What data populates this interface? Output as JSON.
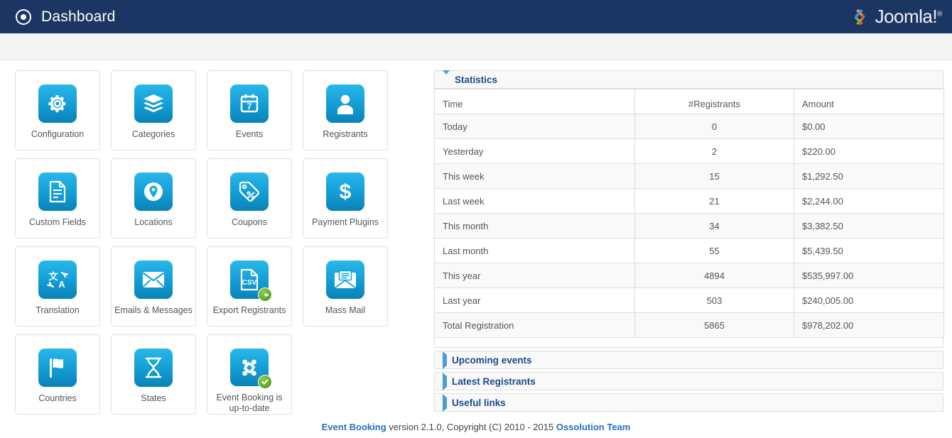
{
  "header": {
    "title": "Dashboard",
    "dashboard_icon": "target-icon",
    "brand_name": "Joomla!",
    "brand_tm": "®",
    "bar_color": "#1c3664"
  },
  "tiles": [
    [
      {
        "label": "Configuration",
        "icon": "gear-icon"
      },
      {
        "label": "Categories",
        "icon": "layers-icon"
      },
      {
        "label": "Events",
        "icon": "calendar-icon",
        "icon_text": "7"
      },
      {
        "label": "Registrants",
        "icon": "user-icon"
      }
    ],
    [
      {
        "label": "Custom Fields",
        "icon": "document-icon"
      },
      {
        "label": "Locations",
        "icon": "map-pin-icon"
      },
      {
        "label": "Coupons",
        "icon": "tag-percent-icon"
      },
      {
        "label": "Payment Plugins",
        "icon": "dollar-icon"
      }
    ],
    [
      {
        "label": "Translation",
        "icon": "translate-icon"
      },
      {
        "label": "Emails & Messages",
        "icon": "envelope-icon"
      },
      {
        "label": "Export Registrants",
        "icon": "csv-file-icon",
        "badge": "arrow-left-badge"
      },
      {
        "label": "Mass Mail",
        "icon": "open-envelope-icon"
      }
    ],
    [
      {
        "label": "Countries",
        "icon": "flag-icon"
      },
      {
        "label": "States",
        "icon": "hourglass-icon"
      },
      {
        "label": "Event Booking is up-to-date",
        "icon": "joomla-icon",
        "badge": "check-badge"
      }
    ]
  ],
  "statistics": {
    "panel_title": "Statistics",
    "columns": [
      "Time",
      "#Registrants",
      "Amount"
    ],
    "rows": [
      {
        "time": "Today",
        "registrants": "0",
        "amount": "$0.00"
      },
      {
        "time": "Yesterday",
        "registrants": "2",
        "amount": "$220.00"
      },
      {
        "time": "This week",
        "registrants": "15",
        "amount": "$1,292.50"
      },
      {
        "time": "Last week",
        "registrants": "21",
        "amount": "$2,244.00"
      },
      {
        "time": "This month",
        "registrants": "34",
        "amount": "$3,382.50"
      },
      {
        "time": "Last month",
        "registrants": "55",
        "amount": "$5,439.50"
      },
      {
        "time": "This year",
        "registrants": "4894",
        "amount": "$535,997.00"
      },
      {
        "time": "Last year",
        "registrants": "503",
        "amount": "$240,005.00"
      },
      {
        "time": "Total Registration",
        "registrants": "5865",
        "amount": "$978,202.00"
      }
    ]
  },
  "collapsed_panels": [
    {
      "title": "Upcoming events"
    },
    {
      "title": "Latest Registrants"
    },
    {
      "title": "Useful links"
    }
  ],
  "footer": {
    "product": "Event Booking",
    "text": " version 2.1.0, Copyright (C) 2010 - 2015 ",
    "company": "Ossolution Team",
    "link_color": "#2b6fc4"
  }
}
